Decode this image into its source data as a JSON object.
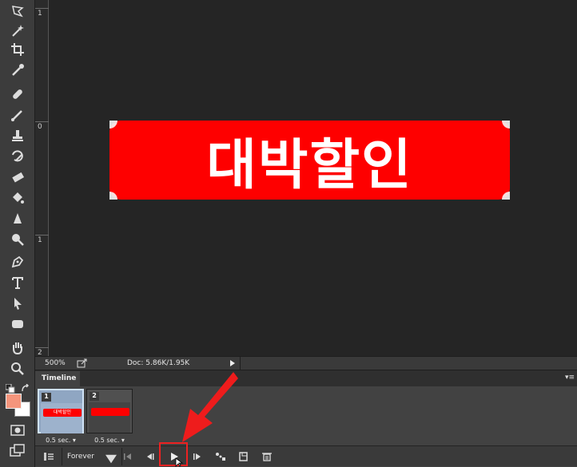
{
  "canvas": {
    "banner_text": "대박할인",
    "banner_color": "#fe0000",
    "text_color": "#ffffff"
  },
  "ruler": {
    "labels": [
      "1",
      "0",
      "1",
      "2"
    ]
  },
  "status": {
    "zoom": "500%",
    "doc": "Doc: 5.86K/1.95K"
  },
  "timeline": {
    "tab_label": "Timeline",
    "menu_glyph": "▾≡",
    "frames": [
      {
        "number": "1",
        "thumb_text": "대박할인",
        "delay": "0.5 sec.",
        "selected": true
      },
      {
        "number": "2",
        "thumb_text": "",
        "delay": "0.5 sec.",
        "selected": false
      }
    ],
    "loop": "Forever",
    "controls": [
      "convert-icon",
      "first-frame-icon",
      "prev-frame-icon",
      "play-icon",
      "next-frame-icon",
      "tween-icon",
      "duplicate-frame-icon",
      "trash-icon"
    ]
  },
  "tools": [
    "lasso-icon",
    "magic-wand-icon",
    "crop-icon",
    "eyedropper-icon",
    "healing-brush-icon",
    "brush-icon",
    "clone-stamp-icon",
    "history-brush-icon",
    "eraser-icon",
    "paint-bucket-icon",
    "blur-icon",
    "dodge-icon",
    "pen-icon",
    "type-icon",
    "path-selection-icon",
    "rectangle-icon",
    "hand-icon",
    "zoom-icon"
  ],
  "colors": {
    "foreground": "#f4957c",
    "background": "#ffffff",
    "highlight": "#e22222"
  }
}
